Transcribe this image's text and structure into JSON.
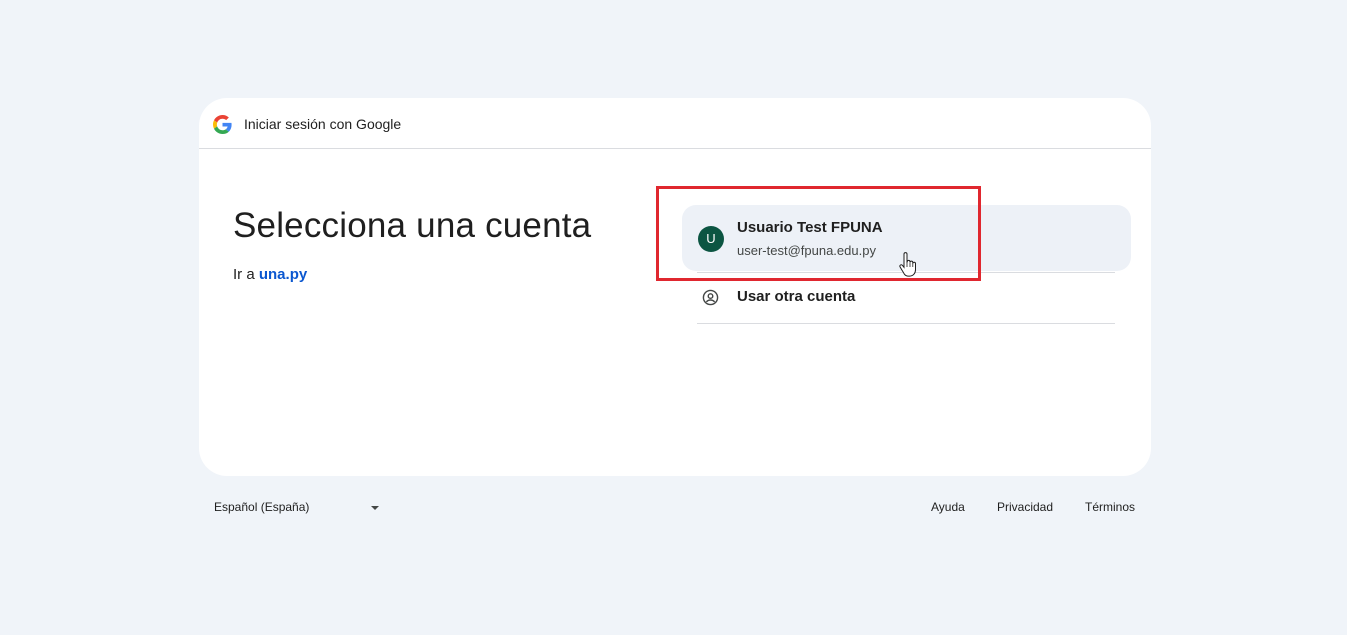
{
  "header": {
    "title": "Iniciar sesión con Google"
  },
  "main": {
    "heading": "Selecciona una cuenta",
    "goto_prefix": "Ir a",
    "goto_link": "una.py"
  },
  "accounts": [
    {
      "avatar_letter": "U",
      "name": "Usuario Test FPUNA",
      "email": "user-test@fpuna.edu.py",
      "avatar_color": "#0c5542"
    }
  ],
  "other_account": {
    "label": "Usar otra cuenta",
    "icon": "account-circle-icon"
  },
  "footer": {
    "language": "Español (España)",
    "links": {
      "help": "Ayuda",
      "privacy": "Privacidad",
      "terms": "Términos"
    }
  },
  "colors": {
    "page_bg": "#f0f4f9",
    "link": "#0b57d0",
    "highlight_box": "#e0272f"
  }
}
